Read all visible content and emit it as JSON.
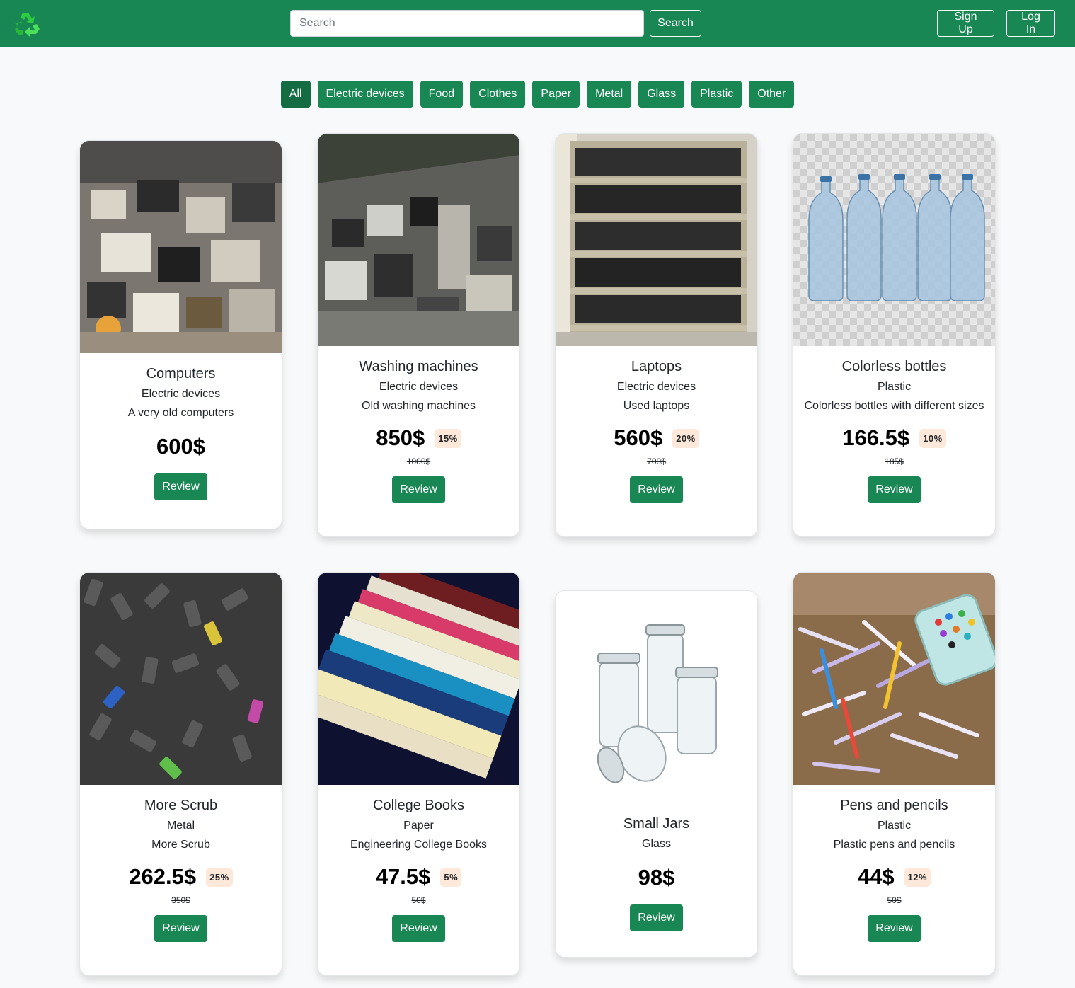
{
  "header": {
    "logo_icon": "recycle-icon",
    "search_placeholder": "Search",
    "search_button": "Search",
    "signup_label": "Sign Up",
    "login_label": "Log In"
  },
  "filters": {
    "active": "All",
    "items": [
      "All",
      "Electric devices",
      "Food",
      "Clothes",
      "Paper",
      "Metal",
      "Glass",
      "Plastic",
      "Other"
    ]
  },
  "review_label": "Review",
  "products": [
    {
      "title": "Computers",
      "category": "Electric devices",
      "description": "A very old computers",
      "price": "600$",
      "discount": "",
      "old_price": "",
      "image": "e-waste-pile-image"
    },
    {
      "title": "Washing machines",
      "category": "Electric devices",
      "description": "Old washing machines",
      "price": "850$",
      "discount": "15%",
      "old_price": "1000$",
      "image": "appliance-scrap-pile-image"
    },
    {
      "title": "Laptops",
      "category": "Electric devices",
      "description": "Used laptops",
      "price": "560$",
      "discount": "20%",
      "old_price": "700$",
      "image": "laptop-shelves-image"
    },
    {
      "title": "Colorless bottles",
      "category": "Plastic",
      "description": "Colorless bottles with different sizes",
      "price": "166.5$",
      "discount": "10%",
      "old_price": "185$",
      "image": "plastic-bottles-image"
    },
    {
      "title": "More Scrub",
      "category": "Metal",
      "description": "More Scrub",
      "price": "262.5$",
      "discount": "25%",
      "old_price": "350$",
      "image": "old-phones-pile-image"
    },
    {
      "title": "College Books",
      "category": "Paper",
      "description": "Engineering College Books",
      "price": "47.5$",
      "discount": "5%",
      "old_price": "50$",
      "image": "book-stack-image"
    },
    {
      "title": "Small Jars",
      "category": "Glass",
      "description": "",
      "price": "98$",
      "discount": "",
      "old_price": "",
      "image": "glass-jars-image"
    },
    {
      "title": "Pens and pencils",
      "category": "Plastic",
      "description": "Plastic pens and pencils",
      "price": "44$",
      "discount": "12%",
      "old_price": "50$",
      "image": "pens-pile-image"
    }
  ],
  "colors": {
    "brand": "#198754",
    "brand_active": "#146c43",
    "discount_badge": "#fde8d9",
    "page_background": "#f8f9fa"
  }
}
